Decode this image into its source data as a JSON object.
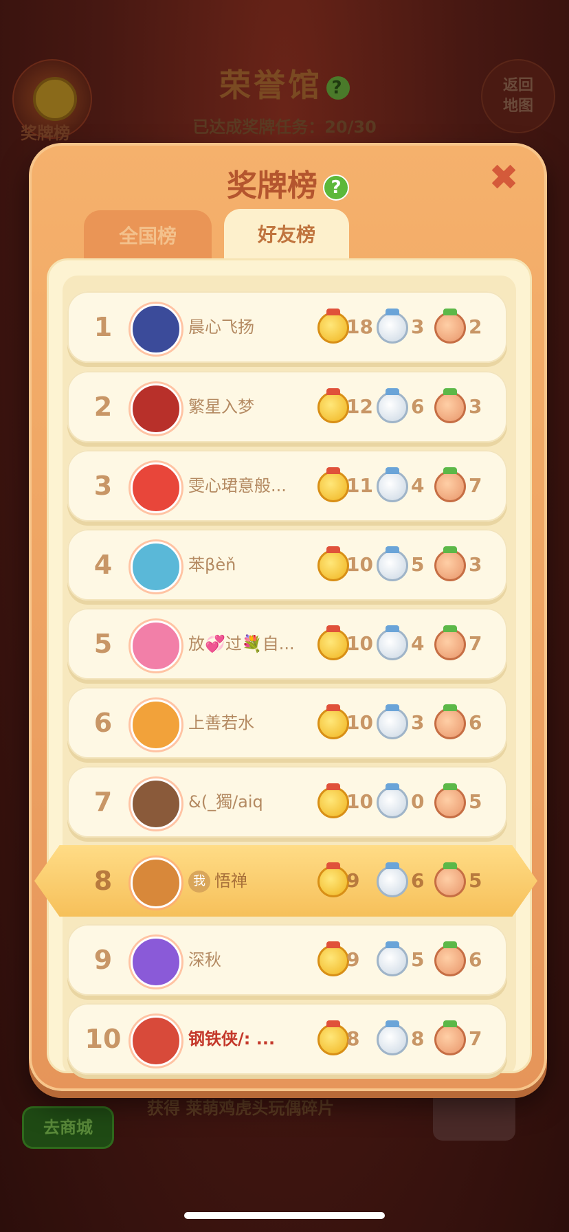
{
  "background": {
    "title": "荣誉馆",
    "progress_label": "已达成奖牌任务：",
    "progress_value": "20/30",
    "medal_button_label": "奖牌榜",
    "back_button_label": "返回\n地图",
    "reward_text": "获得 莱萌鸡虎头玩偶碎片",
    "shop_button_label": "去商城",
    "help_icon": "?"
  },
  "modal": {
    "title": "奖牌榜",
    "help_icon": "?",
    "close_icon": "✖",
    "tabs": [
      {
        "label": "全国榜",
        "active": false
      },
      {
        "label": "好友榜",
        "active": true
      }
    ],
    "me_badge": "我"
  },
  "colors": {
    "accent": "#f5b16c",
    "highlight_row": "#f6c05a",
    "rank_text": "#c89666"
  },
  "leaderboard": [
    {
      "rank": "1",
      "name": "晨心飞扬",
      "gold": "18",
      "silver": "3",
      "bronze": "2",
      "avatar_color": "#3b4b9a",
      "me": false
    },
    {
      "rank": "2",
      "name": "繁星入梦",
      "gold": "12",
      "silver": "6",
      "bronze": "3",
      "avatar_color": "#b8302a",
      "me": false
    },
    {
      "rank": "3",
      "name": "雯心珺意般...",
      "gold": "11",
      "silver": "4",
      "bronze": "7",
      "avatar_color": "#e8463a",
      "me": false
    },
    {
      "rank": "4",
      "name": "苯βèň",
      "gold": "10",
      "silver": "5",
      "bronze": "3",
      "avatar_color": "#5ab8d8",
      "me": false
    },
    {
      "rank": "5",
      "name": "放💞过💐自...",
      "gold": "10",
      "silver": "4",
      "bronze": "7",
      "avatar_color": "#f27fa8",
      "me": false
    },
    {
      "rank": "6",
      "name": "上善若水",
      "gold": "10",
      "silver": "3",
      "bronze": "6",
      "avatar_color": "#f2a23a",
      "me": false
    },
    {
      "rank": "7",
      "name": "&(_獨/aiq",
      "gold": "10",
      "silver": "0",
      "bronze": "5",
      "avatar_color": "#8a5a3a",
      "me": false
    },
    {
      "rank": "8",
      "name": "悟禅",
      "gold": "9",
      "silver": "6",
      "bronze": "5",
      "avatar_color": "#d8883a",
      "me": true
    },
    {
      "rank": "9",
      "name": "深秋",
      "gold": "9",
      "silver": "5",
      "bronze": "6",
      "avatar_color": "#8a5ad8",
      "me": false
    },
    {
      "rank": "10",
      "name": "钢铁侠/: ...",
      "gold": "8",
      "silver": "8",
      "bronze": "7",
      "avatar_color": "#d84a3a",
      "me": false
    }
  ]
}
